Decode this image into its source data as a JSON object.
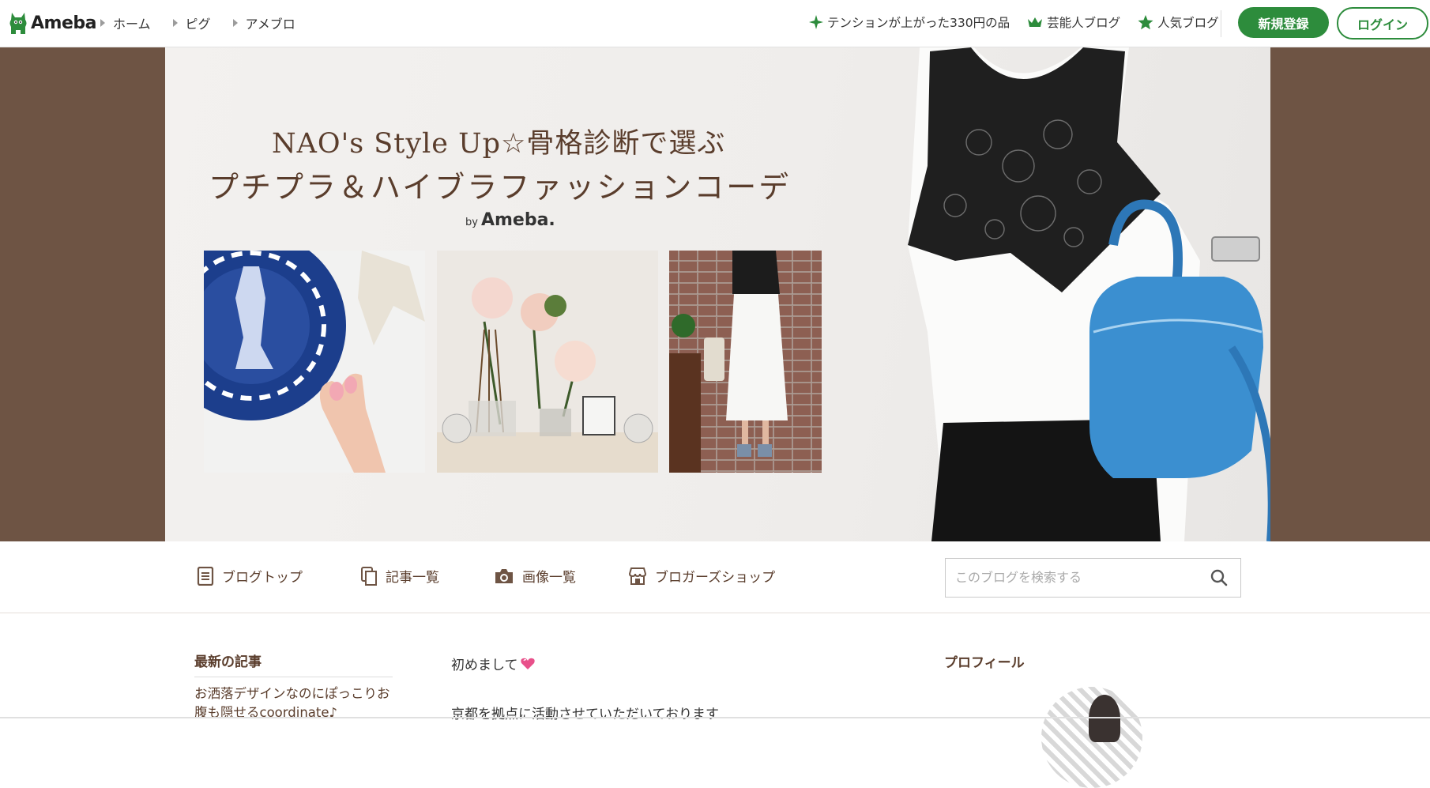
{
  "header": {
    "logo_text": "Ameba",
    "breadcrumbs": [
      "ホーム",
      "ピグ",
      "アメブロ"
    ],
    "links": [
      {
        "label": "テンションが上がった330円の品",
        "icon": "sparkle-icon"
      },
      {
        "label": "芸能人ブログ",
        "icon": "crown-icon"
      },
      {
        "label": "人気ブログ",
        "icon": "star-icon"
      }
    ],
    "register_label": "新規登録",
    "login_label": "ログイン"
  },
  "banner": {
    "title_line1": "NAO's Style Up☆骨格診断で選ぶ",
    "title_line2": "プチプラ＆ハイブラファッションコーデ",
    "by_prefix": "by",
    "by_brand": "Ameba."
  },
  "blog_nav": {
    "items": [
      {
        "label": "ブログトップ",
        "icon": "document-icon"
      },
      {
        "label": "記事一覧",
        "icon": "copy-icon"
      },
      {
        "label": "画像一覧",
        "icon": "camera-icon"
      },
      {
        "label": "ブロガーズショップ",
        "icon": "shop-icon"
      }
    ],
    "search_placeholder": "このブログを検索する"
  },
  "sidebar": {
    "latest_title": "最新の記事",
    "latest_item": "お洒落デザインなのにぽっこりお腹も隠せるcoordinate♪"
  },
  "post": {
    "line1": "初めまして",
    "line2": "京都を拠点に活動させていただいております"
  },
  "profile": {
    "title": "プロフィール"
  },
  "colors": {
    "brand_green": "#2d8c3c",
    "banner_brown": "#6e5444",
    "text_brown": "#5a3d2c"
  }
}
